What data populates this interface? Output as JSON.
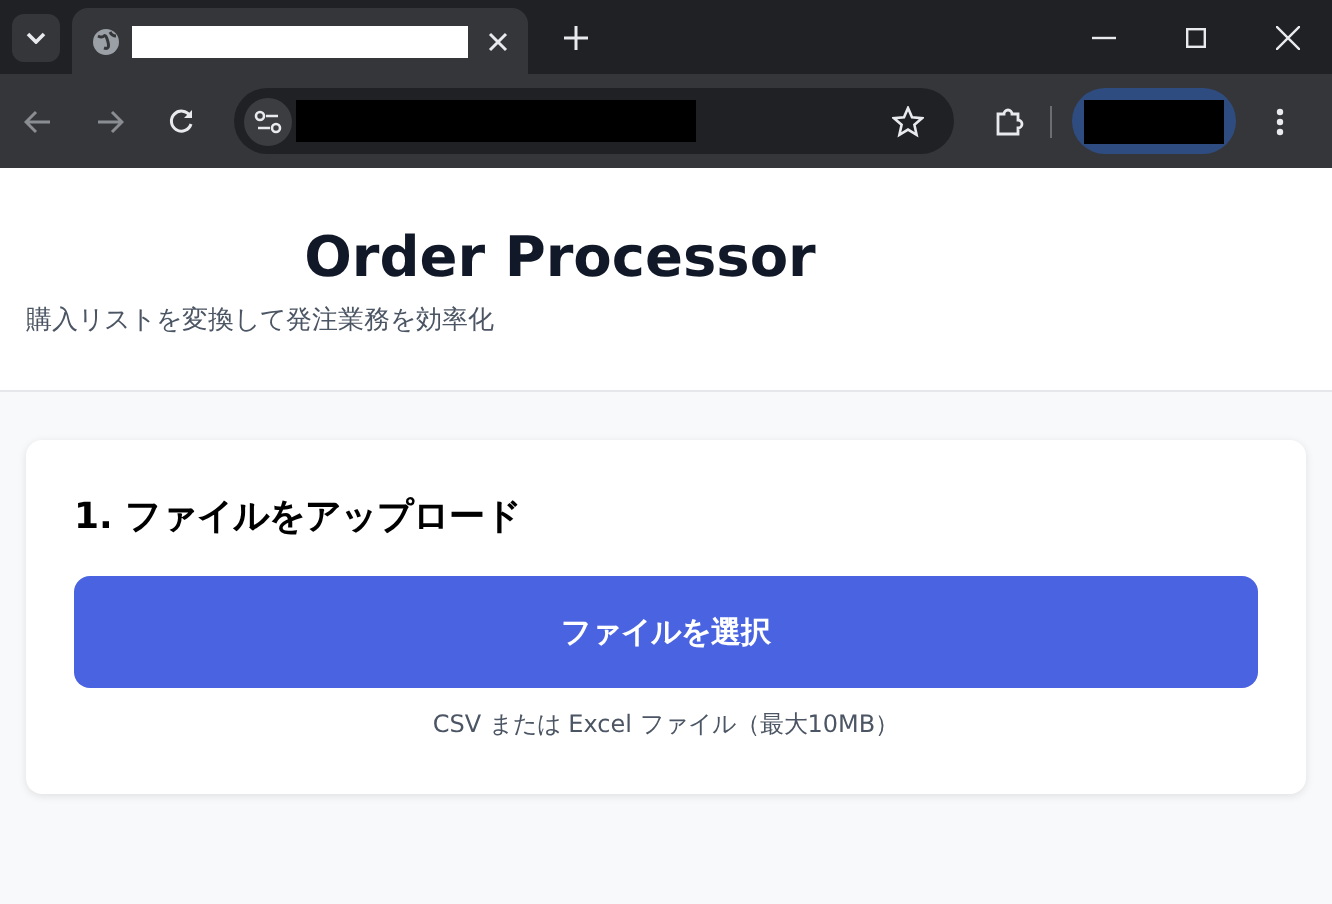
{
  "browser": {
    "tabs": [
      {
        "selected": true
      }
    ]
  },
  "header": {
    "title": "Order Processor",
    "subtitle": "購入リストを変換して発注業務を効率化"
  },
  "upload_card": {
    "heading": "1. ファイルをアップロード",
    "button": "ファイルを選択",
    "hint": "CSV または Excel ファイル（最大10MB）"
  }
}
